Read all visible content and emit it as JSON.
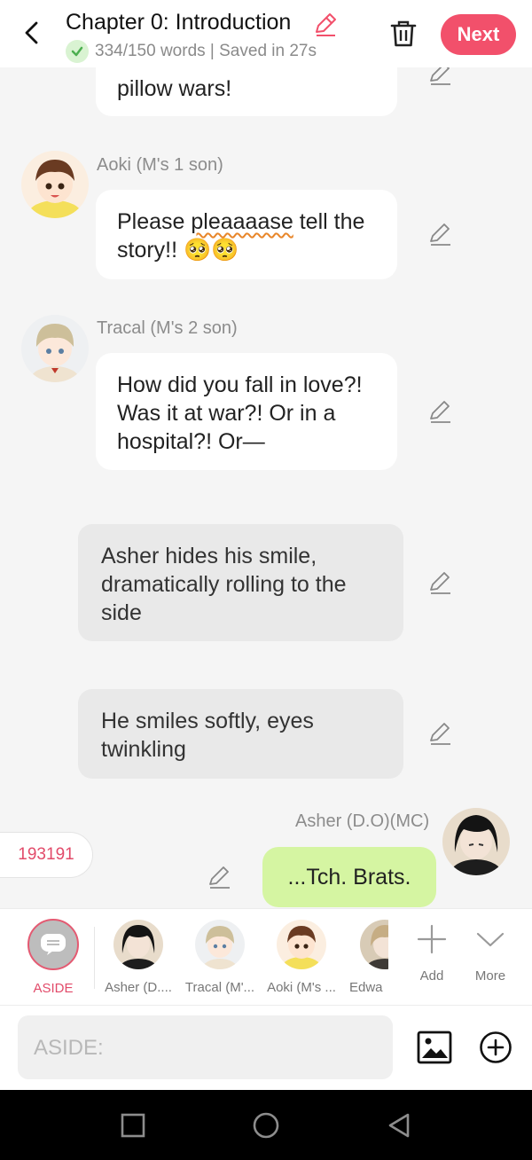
{
  "header": {
    "title": "Chapter 0: Introduction",
    "status": "334/150 words | Saved in 27s",
    "next_label": "Next"
  },
  "messages": [
    {
      "type": "character",
      "text": "pillow wars!"
    },
    {
      "type": "character",
      "name": "Aoki (M's 1 son)",
      "text_pre": "Please ",
      "text_mark": "pleaaaase",
      "text_post": " tell the story!! 🥺🥺"
    },
    {
      "type": "character",
      "name": "Tracal (M's 2 son)",
      "text": "How did you fall in love?! Was it at war?! Or in a hospital?! Or—"
    },
    {
      "type": "aside",
      "text": "Asher hides his smile, dramatically rolling to the side"
    },
    {
      "type": "aside",
      "text": "He smiles softly, eyes twinkling"
    },
    {
      "type": "me",
      "name": "Asher (D.O)(MC)",
      "text": "...Tch. Brats."
    }
  ],
  "count_badge": "193191",
  "char_bar": {
    "aside_label": "ASIDE",
    "items": [
      "Asher (D....",
      "Tracal (M'...",
      "Aoki (M's ...",
      "Edwa"
    ],
    "add_label": "Add",
    "more_label": "More"
  },
  "input": {
    "placeholder": "ASIDE:"
  },
  "colors": {
    "accent": "#f2506b",
    "me_bubble": "#d5f5a2",
    "aside_bubble": "#e9e9e9"
  }
}
